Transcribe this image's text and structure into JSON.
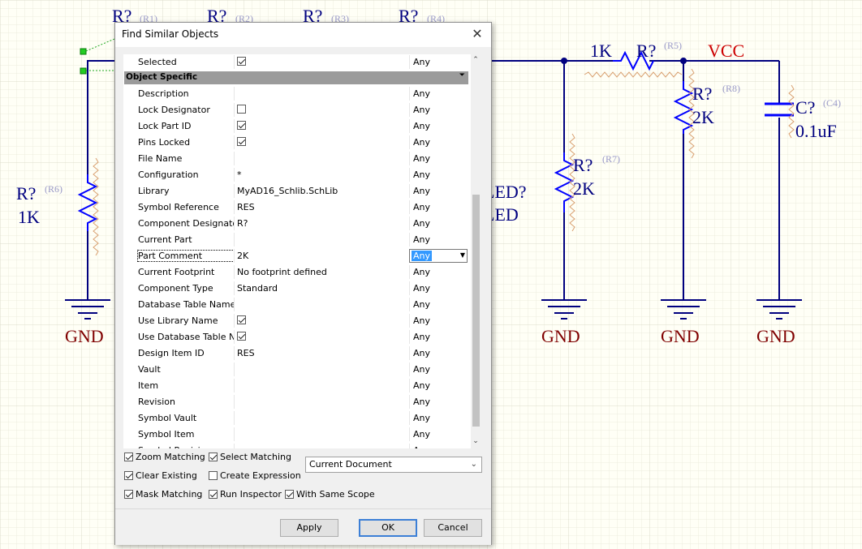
{
  "schematic": {
    "labels": {
      "r1_ref": "(R1)",
      "r2_top_ref": "(R2)",
      "r3_ref": "(R3)",
      "r4_ref": "(R4)",
      "r6_name": "R?",
      "r6_ref": "(R6)",
      "r6_value": "1K",
      "led_name": "LED?",
      "led_value": "LED",
      "r5_value": "1K",
      "r5_name": "R?",
      "r5_ref": "(R5)",
      "vcc": "VCC",
      "r8_name": "R?",
      "r8_ref": "(R8)",
      "r8_value": "2K",
      "r7_name": "R?",
      "r7_ref": "(R7)",
      "r7_value": "2K",
      "c4_name": "C?",
      "c4_ref": "(C4)",
      "c4_value": "0.1uF",
      "gnd": "GND"
    },
    "colors": {
      "wire": "#00007f",
      "component": "#0000ff",
      "text_dark": "#000080",
      "text_red": "#cc0000",
      "ref_gray": "#9a9ac8",
      "gnd_text": "#800000"
    }
  },
  "dialog": {
    "title": "Find Similar Objects",
    "top_row": {
      "name": "Selected",
      "checked": true,
      "match": "Any"
    },
    "section_title": "Object Specific",
    "rows": [
      {
        "name": "Description",
        "value": "",
        "match": "Any"
      },
      {
        "name": "Lock Designator",
        "checkbox": false,
        "match": "Any"
      },
      {
        "name": "Lock Part ID",
        "checkbox": true,
        "match": "Any"
      },
      {
        "name": "Pins Locked",
        "checkbox": true,
        "match": "Any"
      },
      {
        "name": "File Name",
        "value": "",
        "match": "Any"
      },
      {
        "name": "Configuration",
        "value": "*",
        "match": "Any"
      },
      {
        "name": "Library",
        "value": "MyAD16_Schlib.SchLib",
        "match": "Any"
      },
      {
        "name": "Symbol Reference",
        "value": "RES",
        "match": "Any"
      },
      {
        "name": "Component Designato",
        "value": "R?",
        "match": "Any"
      },
      {
        "name": "Current Part",
        "value": "",
        "match": "Any"
      },
      {
        "name": "Part Comment",
        "value": "2K",
        "match": "Any",
        "selected": true
      },
      {
        "name": "Current Footprint",
        "value": "No footprint defined",
        "match": "Any"
      },
      {
        "name": "Component Type",
        "value": "Standard",
        "match": "Any"
      },
      {
        "name": "Database Table Name",
        "value": "",
        "match": "Any"
      },
      {
        "name": "Use Library Name",
        "checkbox": true,
        "match": "Any"
      },
      {
        "name": "Use Database Table Na",
        "checkbox": true,
        "match": "Any"
      },
      {
        "name": "Design Item ID",
        "value": "RES",
        "match": "Any"
      },
      {
        "name": "Vault",
        "value": "",
        "match": "Any"
      },
      {
        "name": "Item",
        "value": "",
        "match": "Any"
      },
      {
        "name": "Revision",
        "value": "",
        "match": "Any"
      },
      {
        "name": "Symbol Vault",
        "value": "",
        "match": "Any"
      },
      {
        "name": "Symbol Item",
        "value": "",
        "match": "Any"
      },
      {
        "name": "Symbol Revision",
        "value": "",
        "match": "Any"
      }
    ],
    "options": {
      "zoom_matching": {
        "label": "Zoom Matching",
        "checked": true
      },
      "select_matching": {
        "label": "Select Matching",
        "checked": true
      },
      "clear_existing": {
        "label": "Clear Existing",
        "checked": true
      },
      "create_expression": {
        "label": "Create Expression",
        "checked": false
      },
      "mask_matching": {
        "label": "Mask Matching",
        "checked": true
      },
      "run_inspector": {
        "label": "Run Inspector",
        "checked": true
      },
      "with_same_scope": {
        "label": "With Same Scope",
        "checked": true
      }
    },
    "scope": "Current Document",
    "buttons": {
      "apply": "Apply",
      "ok": "OK",
      "cancel": "Cancel"
    }
  }
}
